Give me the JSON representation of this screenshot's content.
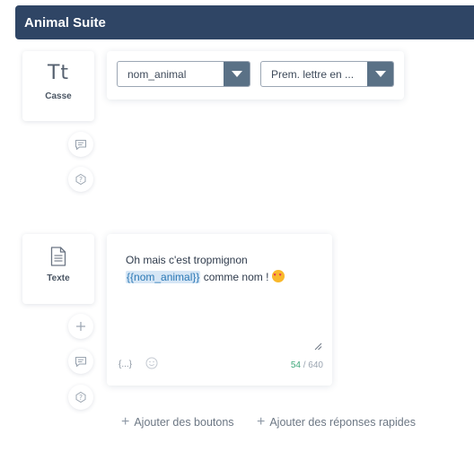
{
  "header": {
    "title": "Animal Suite"
  },
  "blocks": {
    "casse": {
      "icon_text": "Tt",
      "label": "Casse",
      "variable_select": "nom_animal",
      "case_select": "Prem. lettre en ..."
    },
    "texte": {
      "icon": "document-icon",
      "label": "Texte",
      "message_start": "Oh mais c'est tropmignon",
      "variable_token": "{{nom_animal}}",
      "message_end": " comme nom ! ",
      "variable_insert_label": "{...}",
      "char_count_current": "54",
      "char_count_rest": " / 640"
    }
  },
  "actions": {
    "add_buttons": "Ajouter des boutons",
    "add_quick_replies": "Ajouter des réponses rapides"
  },
  "colors": {
    "header": "#2f4565",
    "select_arrow": "#5a7186",
    "token_bg": "#d6e6f5",
    "counter_green": "#3fa87a"
  }
}
